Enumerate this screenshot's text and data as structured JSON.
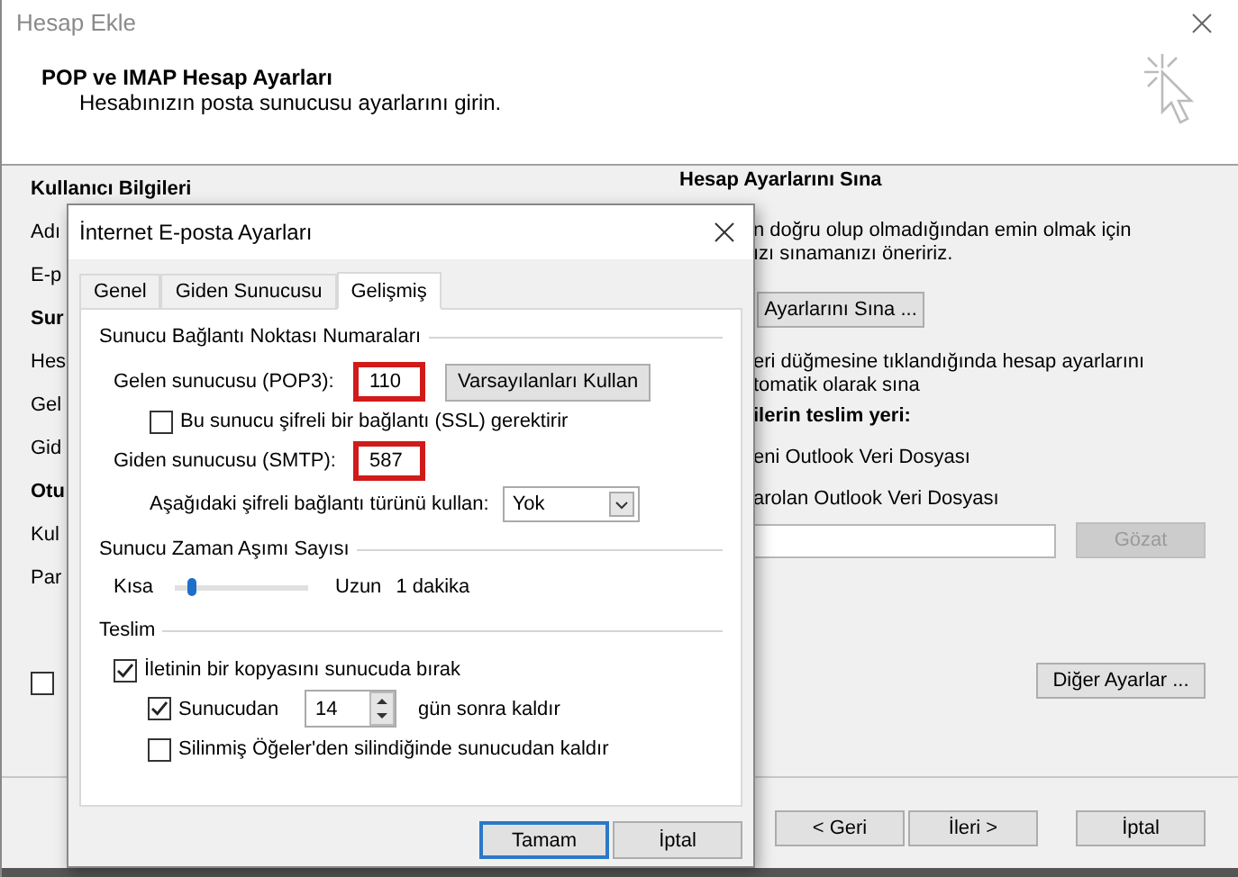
{
  "window": {
    "title": "Hesap Ekle",
    "header": {
      "title": "POP ve IMAP Hesap Ayarları",
      "subtitle": "Hesabınızın posta sunucusu ayarlarını girin."
    },
    "left_column": [
      {
        "kind": "heading",
        "text": "Kullanıcı Bilgileri"
      },
      {
        "kind": "label",
        "text": "Adı"
      },
      {
        "kind": "label",
        "text": "E-p"
      },
      {
        "kind": "heading",
        "text": "Sur"
      },
      {
        "kind": "label",
        "text": "Hes"
      },
      {
        "kind": "label",
        "text": "Gel"
      },
      {
        "kind": "label",
        "text": "Gid"
      },
      {
        "kind": "heading",
        "text": "Otu"
      },
      {
        "kind": "label",
        "text": "Kul"
      },
      {
        "kind": "label",
        "text": "Par"
      }
    ],
    "left_checkbox": {
      "checked": false
    },
    "right_column": {
      "heading": "Hesap Ayarlarını Sına",
      "intro": [
        "n doğru olup olmadığından emin olmak için",
        "ızı sınamanızı öneririz."
      ],
      "test_button": "Ayarlarını Sına ...",
      "auto_test": [
        "eri düğmesine tıklandığında hesap ayarlarını",
        "tomatik olarak sına"
      ],
      "delivery_heading": "ilerin teslim yeri:",
      "options": [
        "eni Outlook Veri Dosyası",
        "arolan Outlook Veri Dosyası"
      ],
      "browse_button": {
        "label": "Gözat",
        "disabled": true
      },
      "more_button": "Diğer Ayarlar ..."
    },
    "buttons": [
      "< Geri",
      "İleri >",
      "İptal"
    ]
  },
  "dialog": {
    "title": "İnternet E-posta Ayarları",
    "tabs": [
      {
        "label": "Genel",
        "selected": false
      },
      {
        "label": "Giden Sunucusu",
        "selected": false
      },
      {
        "label": "Gelişmiş",
        "selected": true
      }
    ],
    "ports_group": "Sunucu Bağlantı Noktası Numaraları",
    "incoming": {
      "label": "Gelen sunucusu (POP3):",
      "value": "110",
      "highlighted": true
    },
    "defaults_button": "Varsayılanları Kullan",
    "ssl": {
      "label": "Bu sunucu şifreli bir bağlantı (SSL) gerektirir",
      "checked": false
    },
    "outgoing": {
      "label": "Giden sunucusu (SMTP):",
      "value": "587",
      "highlighted": true
    },
    "encryption": {
      "label": "Aşağıdaki şifreli bağlantı türünü kullan:",
      "value": "Yok"
    },
    "timeout_group": "Sunucu Zaman Aşımı Sayısı",
    "timeout": {
      "min_label": "Kısa",
      "max_label": "Uzun",
      "level": 0.1,
      "reading": "1 dakika"
    },
    "delivery_group": "Teslim",
    "leave_copy": {
      "label": "İletinin bir kopyasını sunucuda bırak",
      "checked": true
    },
    "remove_after": {
      "label": "Sunucudan",
      "checked": true,
      "days": "14",
      "suffix": "gün sonra kaldır"
    },
    "remove_deleted": {
      "label": "Silinmiş Öğeler'den silindiğinde sunucudan kaldır",
      "checked": false
    },
    "buttons": [
      {
        "label": "Tamam",
        "default": true
      },
      {
        "label": "İptal",
        "default": false
      }
    ]
  }
}
